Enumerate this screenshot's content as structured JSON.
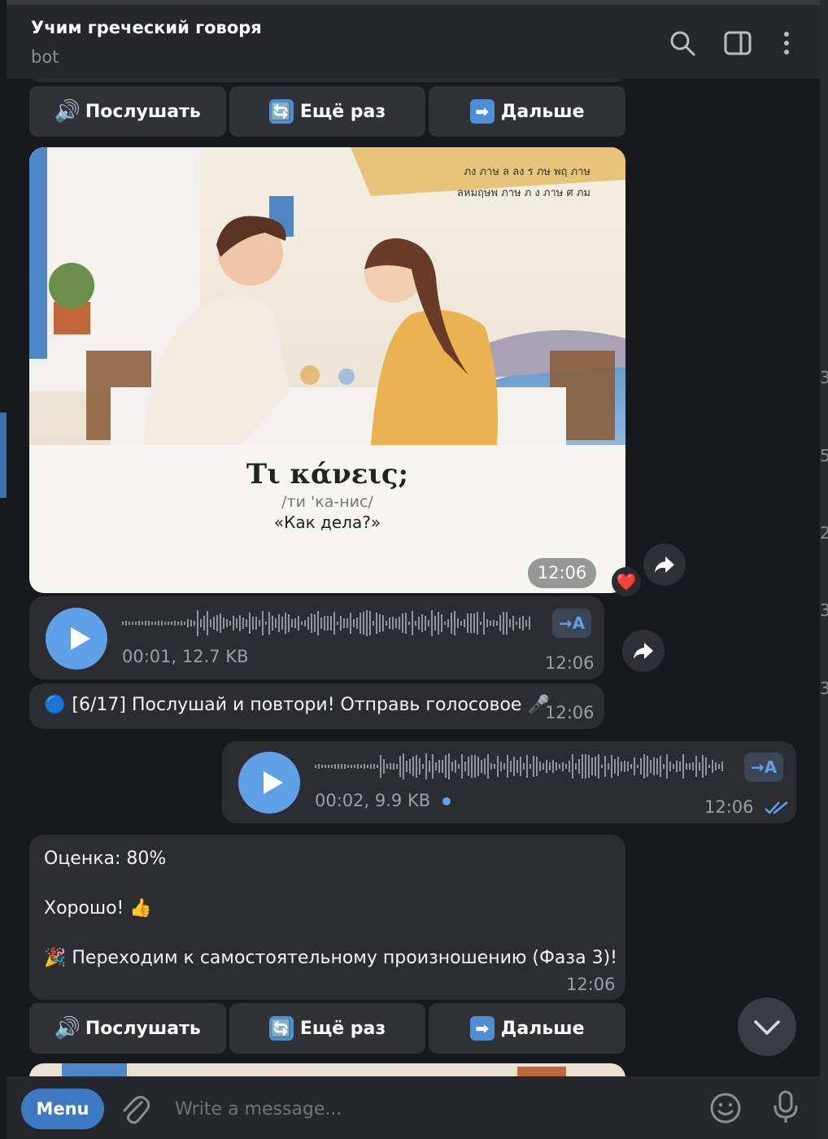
{
  "header": {
    "title": "Учим греческий говоря",
    "subtitle": "bot"
  },
  "keyboard": {
    "listen": "Послушать",
    "again": "Ещё раз",
    "next": "Дальше"
  },
  "photo": {
    "greek_phrase": "Τι κάνεις;",
    "transcription": "/ти 'ка-нис/",
    "translation": "«Как дела?»",
    "time": "12:06",
    "reaction": "❤️"
  },
  "voice_in": {
    "duration_size": "00:01, 12.7 KB",
    "time": "12:06",
    "translate_label": "→A"
  },
  "task_msg": {
    "emoji": "🔵",
    "text": "[6/17] Послушай и повтори! Отправь голосовое 🎤",
    "time": "12:06"
  },
  "voice_out": {
    "duration_size": "00:02, 9.9 KB",
    "time": "12:06",
    "translate_label": "→A"
  },
  "score_msg": {
    "line1": "Оценка: 80%",
    "line2": "Хорошо! 👍",
    "line3": "🎉 Переходим к самостоятельному произношению (Фаза 3)!",
    "time": "12:06"
  },
  "composer": {
    "menu": "Menu",
    "placeholder": "Write a message..."
  },
  "edge_digits": [
    "3",
    "5",
    "2",
    "3",
    "3"
  ],
  "colors": {
    "accent": "#5ea1e6",
    "menu": "#3e7ac4",
    "bubble": "#2b2d31",
    "background": "#18191c"
  }
}
